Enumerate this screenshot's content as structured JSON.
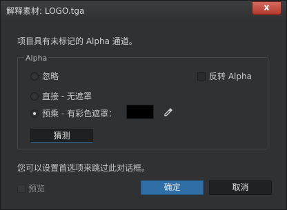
{
  "window": {
    "title": "解释素材: LOGO.tga",
    "close_glyph": "x"
  },
  "intro_text": "项目具有未标记的 Alpha 通道。",
  "alpha_group": {
    "title": "Alpha",
    "options": [
      {
        "label": "忽略",
        "selected": false
      },
      {
        "label": "直接 - 无遮罩",
        "selected": false
      },
      {
        "label": "预乘 - 有彩色遮罩：",
        "selected": true
      }
    ],
    "invert_label": "反转 Alpha",
    "invert_checked": false,
    "matte_color": "#000000",
    "guess_label": "猜测"
  },
  "preferences_text": "您可以设置首选项来跳过此对话框。",
  "preview_label": "预览",
  "preview_checked": false,
  "buttons": {
    "ok": "确定",
    "cancel": "取消"
  },
  "colors": {
    "accent": "#2f6fa6",
    "close": "#c8473a",
    "background": "#2f3133"
  }
}
